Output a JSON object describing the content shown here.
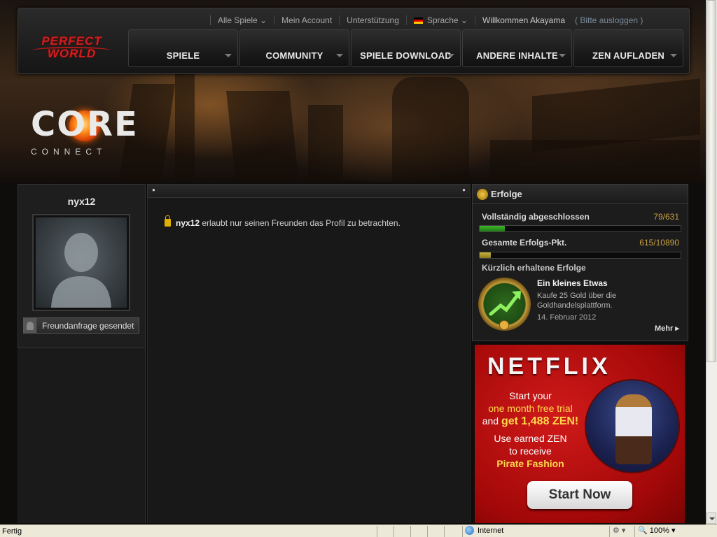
{
  "header": {
    "brand": "PERFECT WORLD",
    "brand_line1": "PERFECT",
    "brand_line2": "WORLD",
    "top_links": [
      "Alle Spiele",
      "Mein Account",
      "Unterstützung",
      "Sprache"
    ],
    "welcome": "Willkommen Akayama",
    "logout": "( Bitte ausloggen )",
    "nav": [
      "SPIELE",
      "COMMUNITY",
      "SPIELE DOWNLOAD",
      "ANDERE INHALTE",
      "ZEN AUFLADEN"
    ]
  },
  "hero": {
    "logo_word": "CORE",
    "logo_sub": "CONNECT"
  },
  "profile": {
    "username": "nyx12",
    "friend_request": "Freundanfrage gesendet"
  },
  "center": {
    "privacy_user": "nyx12",
    "privacy_text": "erlaubt nur seinen Freunden das Profil zu betrachten."
  },
  "achievements": {
    "title": "Erfolge",
    "completed_label": "Vollständig abgeschlossen",
    "completed_value": "79/631",
    "completed_fraction": 0.125,
    "points_label": "Gesamte Erfolgs-Pkt.",
    "points_value": "615/10890",
    "points_fraction": 0.056,
    "recent_label": "Kürzlich erhaltene Erfolge",
    "recent_name": "Ein kleines Etwas",
    "recent_desc": "Kaufe 25 Gold über die Goldhandelsplattform.",
    "recent_date": "14. Februar 2012",
    "more": "Mehr",
    "completed_color": "#3fb52a",
    "points_color": "#c9b33a"
  },
  "ad": {
    "brand": "NETFLIX",
    "line1": "Start your",
    "line2": "one month free trial",
    "line3a": "and ",
    "line3b": "get 1,488 ZEN!",
    "line4": "Use earned ZEN",
    "line5": "to receive",
    "line6": "Pirate Fashion",
    "cta": "Start Now"
  },
  "statusbar": {
    "status": "Fertig",
    "zone": "Internet",
    "zoom": "100%"
  }
}
